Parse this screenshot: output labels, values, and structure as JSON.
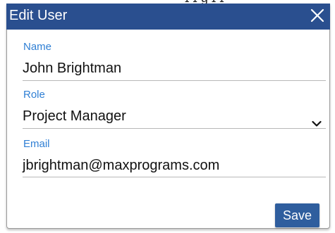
{
  "dialog": {
    "title": "Edit User"
  },
  "fields": {
    "name": {
      "label": "Name",
      "value": "John Brightman"
    },
    "role": {
      "label": "Role",
      "value": "Project Manager"
    },
    "email": {
      "label": "Email",
      "value": "jbrightman@maxprograms.com"
    }
  },
  "actions": {
    "save_label": "Save"
  },
  "icons": {
    "close": "close-icon",
    "dropdown": "chevron-down-icon"
  },
  "colors": {
    "titlebar": "#2a4f8f",
    "label": "#2f7fd4",
    "button": "#2f5e9e"
  }
}
